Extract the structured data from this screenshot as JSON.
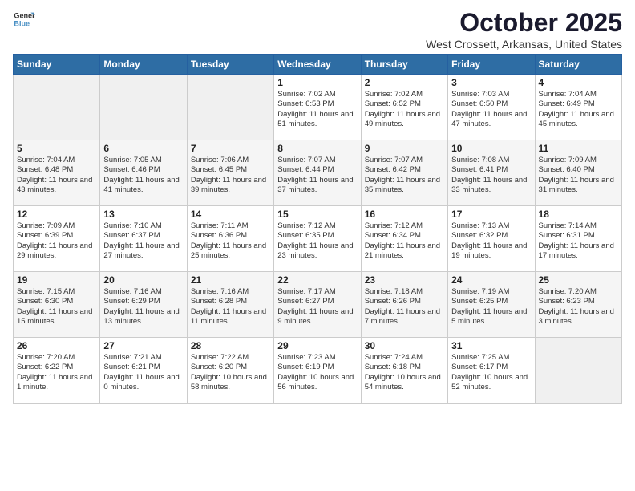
{
  "header": {
    "logo_general": "General",
    "logo_blue": "Blue",
    "title": "October 2025",
    "location": "West Crossett, Arkansas, United States"
  },
  "calendar": {
    "days_of_week": [
      "Sunday",
      "Monday",
      "Tuesday",
      "Wednesday",
      "Thursday",
      "Friday",
      "Saturday"
    ],
    "weeks": [
      [
        {
          "day": "",
          "info": ""
        },
        {
          "day": "",
          "info": ""
        },
        {
          "day": "",
          "info": ""
        },
        {
          "day": "1",
          "info": "Sunrise: 7:02 AM\nSunset: 6:53 PM\nDaylight: 11 hours\nand 51 minutes."
        },
        {
          "day": "2",
          "info": "Sunrise: 7:02 AM\nSunset: 6:52 PM\nDaylight: 11 hours\nand 49 minutes."
        },
        {
          "day": "3",
          "info": "Sunrise: 7:03 AM\nSunset: 6:50 PM\nDaylight: 11 hours\nand 47 minutes."
        },
        {
          "day": "4",
          "info": "Sunrise: 7:04 AM\nSunset: 6:49 PM\nDaylight: 11 hours\nand 45 minutes."
        }
      ],
      [
        {
          "day": "5",
          "info": "Sunrise: 7:04 AM\nSunset: 6:48 PM\nDaylight: 11 hours\nand 43 minutes."
        },
        {
          "day": "6",
          "info": "Sunrise: 7:05 AM\nSunset: 6:46 PM\nDaylight: 11 hours\nand 41 minutes."
        },
        {
          "day": "7",
          "info": "Sunrise: 7:06 AM\nSunset: 6:45 PM\nDaylight: 11 hours\nand 39 minutes."
        },
        {
          "day": "8",
          "info": "Sunrise: 7:07 AM\nSunset: 6:44 PM\nDaylight: 11 hours\nand 37 minutes."
        },
        {
          "day": "9",
          "info": "Sunrise: 7:07 AM\nSunset: 6:42 PM\nDaylight: 11 hours\nand 35 minutes."
        },
        {
          "day": "10",
          "info": "Sunrise: 7:08 AM\nSunset: 6:41 PM\nDaylight: 11 hours\nand 33 minutes."
        },
        {
          "day": "11",
          "info": "Sunrise: 7:09 AM\nSunset: 6:40 PM\nDaylight: 11 hours\nand 31 minutes."
        }
      ],
      [
        {
          "day": "12",
          "info": "Sunrise: 7:09 AM\nSunset: 6:39 PM\nDaylight: 11 hours\nand 29 minutes."
        },
        {
          "day": "13",
          "info": "Sunrise: 7:10 AM\nSunset: 6:37 PM\nDaylight: 11 hours\nand 27 minutes."
        },
        {
          "day": "14",
          "info": "Sunrise: 7:11 AM\nSunset: 6:36 PM\nDaylight: 11 hours\nand 25 minutes."
        },
        {
          "day": "15",
          "info": "Sunrise: 7:12 AM\nSunset: 6:35 PM\nDaylight: 11 hours\nand 23 minutes."
        },
        {
          "day": "16",
          "info": "Sunrise: 7:12 AM\nSunset: 6:34 PM\nDaylight: 11 hours\nand 21 minutes."
        },
        {
          "day": "17",
          "info": "Sunrise: 7:13 AM\nSunset: 6:32 PM\nDaylight: 11 hours\nand 19 minutes."
        },
        {
          "day": "18",
          "info": "Sunrise: 7:14 AM\nSunset: 6:31 PM\nDaylight: 11 hours\nand 17 minutes."
        }
      ],
      [
        {
          "day": "19",
          "info": "Sunrise: 7:15 AM\nSunset: 6:30 PM\nDaylight: 11 hours\nand 15 minutes."
        },
        {
          "day": "20",
          "info": "Sunrise: 7:16 AM\nSunset: 6:29 PM\nDaylight: 11 hours\nand 13 minutes."
        },
        {
          "day": "21",
          "info": "Sunrise: 7:16 AM\nSunset: 6:28 PM\nDaylight: 11 hours\nand 11 minutes."
        },
        {
          "day": "22",
          "info": "Sunrise: 7:17 AM\nSunset: 6:27 PM\nDaylight: 11 hours\nand 9 minutes."
        },
        {
          "day": "23",
          "info": "Sunrise: 7:18 AM\nSunset: 6:26 PM\nDaylight: 11 hours\nand 7 minutes."
        },
        {
          "day": "24",
          "info": "Sunrise: 7:19 AM\nSunset: 6:25 PM\nDaylight: 11 hours\nand 5 minutes."
        },
        {
          "day": "25",
          "info": "Sunrise: 7:20 AM\nSunset: 6:23 PM\nDaylight: 11 hours\nand 3 minutes."
        }
      ],
      [
        {
          "day": "26",
          "info": "Sunrise: 7:20 AM\nSunset: 6:22 PM\nDaylight: 11 hours\nand 1 minute."
        },
        {
          "day": "27",
          "info": "Sunrise: 7:21 AM\nSunset: 6:21 PM\nDaylight: 11 hours\nand 0 minutes."
        },
        {
          "day": "28",
          "info": "Sunrise: 7:22 AM\nSunset: 6:20 PM\nDaylight: 10 hours\nand 58 minutes."
        },
        {
          "day": "29",
          "info": "Sunrise: 7:23 AM\nSunset: 6:19 PM\nDaylight: 10 hours\nand 56 minutes."
        },
        {
          "day": "30",
          "info": "Sunrise: 7:24 AM\nSunset: 6:18 PM\nDaylight: 10 hours\nand 54 minutes."
        },
        {
          "day": "31",
          "info": "Sunrise: 7:25 AM\nSunset: 6:17 PM\nDaylight: 10 hours\nand 52 minutes."
        },
        {
          "day": "",
          "info": ""
        }
      ]
    ]
  }
}
